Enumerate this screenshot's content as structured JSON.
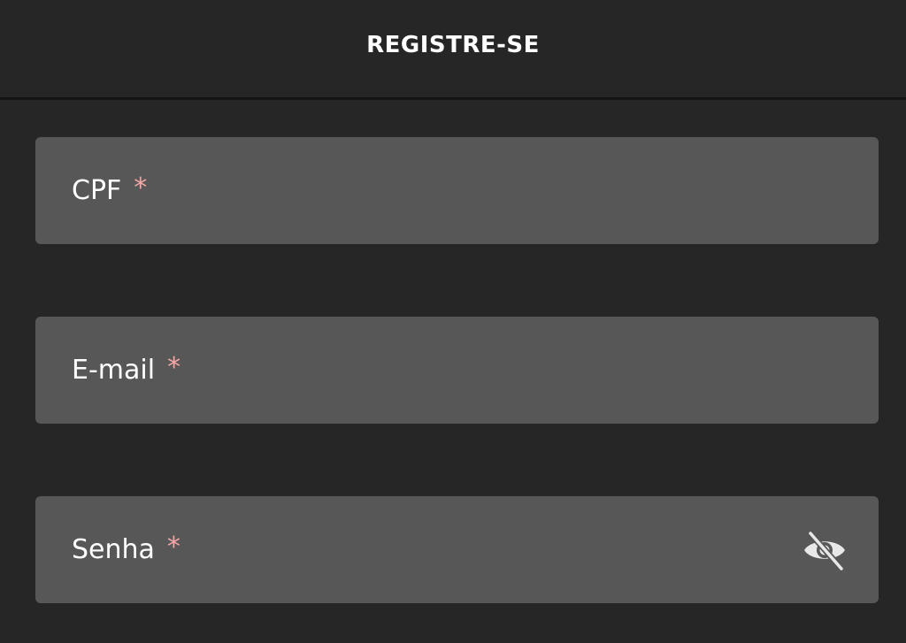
{
  "header": {
    "title": "REGISTRE-SE"
  },
  "form": {
    "fields": [
      {
        "label": "CPF",
        "required_mark": "*"
      },
      {
        "label": "E-mail",
        "required_mark": "*"
      },
      {
        "label": "Senha",
        "required_mark": "*",
        "icon": "eye-off-icon"
      }
    ]
  },
  "colors": {
    "background": "#272626",
    "field_background": "#575757",
    "text": "#ffffff",
    "required": "#f6a6a6",
    "icon": "#e8e8e8"
  }
}
